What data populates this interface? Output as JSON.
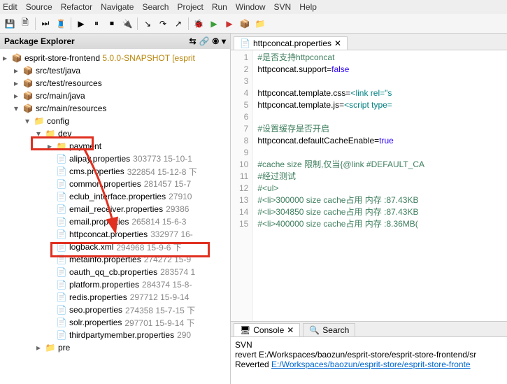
{
  "menu": [
    "Edit",
    "Source",
    "Refactor",
    "Navigate",
    "Search",
    "Project",
    "Run",
    "Window",
    "SVN",
    "Help"
  ],
  "package_explorer": {
    "title": "Package Explorer"
  },
  "project": {
    "name": "esprit-store-frontend",
    "version": "5.0.0-SNAPSHOT [esprit"
  },
  "folders": {
    "src_test_java": "src/test/java",
    "src_test_resources": "src/test/resources",
    "src_main_java": "src/main/java",
    "src_main_resources": "src/main/resources",
    "config": "config",
    "dev": "dev",
    "payment": "payment",
    "pre": "pre"
  },
  "files": [
    {
      "name": "alipay.properties",
      "meta": "303773 15-10-1"
    },
    {
      "name": "cms.properties",
      "meta": "322854 15-12-8 下"
    },
    {
      "name": "common.properties",
      "meta": "281457 15-7"
    },
    {
      "name": "eclub_interface.properties",
      "meta": "27910"
    },
    {
      "name": "email_receiver.properties",
      "meta": "29386"
    },
    {
      "name": "email.properties",
      "meta": "265814 15-6-3"
    },
    {
      "name": "httpconcat.properties",
      "meta": "332977 16-"
    },
    {
      "name": "logback.xml",
      "meta": "294968 15-9-6 下"
    },
    {
      "name": "metainfo.properties",
      "meta": "274272 15-9"
    },
    {
      "name": "oauth_qq_cb.properties",
      "meta": "283574 1"
    },
    {
      "name": "platform.properties",
      "meta": "284374 15-8-"
    },
    {
      "name": "redis.properties",
      "meta": "297712 15-9-14"
    },
    {
      "name": "seo.properties",
      "meta": "274358 15-7-15 下"
    },
    {
      "name": "solr.properties",
      "meta": "297701 15-9-14 下"
    },
    {
      "name": "thirdpartymember.properties",
      "meta": "290"
    }
  ],
  "editor": {
    "tab_title": "httpconcat.properties",
    "lines": [
      {
        "n": 1,
        "text": "#是否支持httpconcat",
        "cls": "c-comment"
      },
      {
        "n": 2,
        "key": "httpconcat.support=",
        "val": "false"
      },
      {
        "n": 3,
        "text": ""
      },
      {
        "n": 4,
        "key": "httpconcat.template.css=",
        "tag": "<link rel=\"s"
      },
      {
        "n": 5,
        "key": "httpconcat.template.js=",
        "tag": "<script type="
      },
      {
        "n": 6,
        "text": ""
      },
      {
        "n": 7,
        "text": "#设置缓存是否开启",
        "cls": "c-comment"
      },
      {
        "n": 8,
        "key": "httpconcat.defaultCacheEnable=",
        "val": "true"
      },
      {
        "n": 9,
        "text": ""
      },
      {
        "n": 10,
        "text": "#cache size 限制,仅当{@link #DEFAULT_CA",
        "cls": "c-comment"
      },
      {
        "n": 11,
        "text": "#经过测试",
        "cls": "c-comment"
      },
      {
        "n": 12,
        "text": "#<ul>",
        "cls": "c-comment"
      },
      {
        "n": 13,
        "text": "#<li>300000 size cache占用 内存 :87.43KB",
        "cls": "c-comment"
      },
      {
        "n": 14,
        "text": "#<li>304850 size cache占用 内存 :87.43KB",
        "cls": "c-comment"
      },
      {
        "n": 15,
        "text": "#<li>400000 size cache占用 内存 :8.36MB(",
        "cls": "c-comment"
      }
    ]
  },
  "console": {
    "tab1": "Console",
    "tab2": "Search",
    "title": "SVN",
    "line1": "revert E:/Workspaces/baozun/esprit-store/esprit-store-frontend/sr",
    "line2_pre": "    Reverted ",
    "line2_link": "E:/Workspaces/baozun/esprit-store/esprit-store-fronte"
  }
}
